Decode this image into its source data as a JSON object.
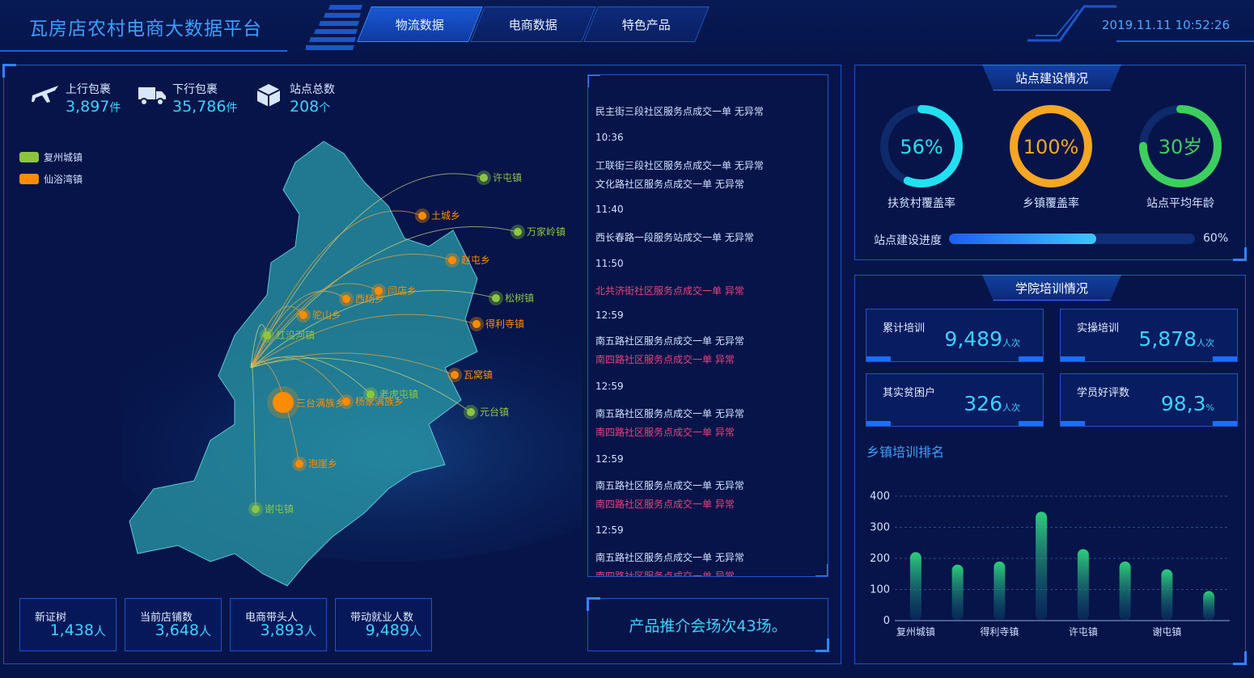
{
  "header": {
    "title": "瓦房店农村电商大数据平台",
    "tabs": [
      {
        "label": "物流数据",
        "active": true
      },
      {
        "label": "电商数据",
        "active": false
      },
      {
        "label": "特色产品",
        "active": false
      }
    ],
    "datetime": "2019.11.11 10:52:26"
  },
  "stats": [
    {
      "label": "上行包裹",
      "value": "3,897",
      "unit": "件",
      "icon": "airplane-icon"
    },
    {
      "label": "下行包裹",
      "value": "35,786",
      "unit": "件",
      "icon": "truck-icon"
    },
    {
      "label": "站点总数",
      "value": "208",
      "unit": "个",
      "icon": "package-icon"
    }
  ],
  "legend": [
    {
      "label": "复州城镇",
      "color": "#8cc63f"
    },
    {
      "label": "仙浴湾镇",
      "color": "#ff8c00"
    }
  ],
  "map": {
    "hub": "三台满族乡",
    "towns": [
      {
        "name": "许屯镇",
        "type": "green"
      },
      {
        "name": "土城乡",
        "type": "orange"
      },
      {
        "name": "万家岭镇",
        "type": "green"
      },
      {
        "name": "赵屯乡",
        "type": "orange"
      },
      {
        "name": "闫店乡",
        "type": "orange"
      },
      {
        "name": "西杨乡",
        "type": "orange"
      },
      {
        "name": "松树镇",
        "type": "green"
      },
      {
        "name": "驼山乡",
        "type": "orange"
      },
      {
        "name": "得利寺镇",
        "type": "orange"
      },
      {
        "name": "红沿河镇",
        "type": "green"
      },
      {
        "name": "瓦窝镇",
        "type": "orange"
      },
      {
        "name": "老虎屯镇",
        "type": "green"
      },
      {
        "name": "杨家满族乡",
        "type": "orange"
      },
      {
        "name": "元台镇",
        "type": "green"
      },
      {
        "name": "泡崖乡",
        "type": "orange"
      },
      {
        "name": "谢屯镇",
        "type": "green"
      }
    ]
  },
  "feed": [
    {
      "text": "民主街三段社区服务点成交一单 无异常",
      "bad": false
    },
    {
      "text": "10:36",
      "bad": false
    },
    {
      "text": "工联街三段社区服务点成交一单 无异常",
      "bad": false
    },
    {
      "text": "文化路社区服务点成交一单 无异常",
      "bad": false
    },
    {
      "text": "11:40",
      "bad": false
    },
    {
      "text": "西长春路一段服务站成交一单 无异常",
      "bad": false
    },
    {
      "text": "11:50",
      "bad": false
    },
    {
      "text": "北共济街社区服务点成交一单 异常",
      "bad": true
    },
    {
      "text": "12:59",
      "bad": false
    },
    {
      "text": "南五路社区服务点成交一单 无异常",
      "bad": false
    },
    {
      "text": "南四路社区服务点成交一单 异常",
      "bad": true
    },
    {
      "text": "12:59",
      "bad": false
    },
    {
      "text": "南五路社区服务点成交一单 无异常",
      "bad": false
    },
    {
      "text": "南四路社区服务点成交一单 异常",
      "bad": true
    },
    {
      "text": "12:59",
      "bad": false
    },
    {
      "text": "南五路社区服务点成交一单 无异常",
      "bad": false
    },
    {
      "text": "南四路社区服务点成交一单 异常",
      "bad": true
    },
    {
      "text": "12:59",
      "bad": false
    },
    {
      "text": "南五路社区服务点成交一单 无异常",
      "bad": false
    },
    {
      "text": "南四路社区服务点成交一单 异常",
      "bad": true
    }
  ],
  "bottom_stats": [
    {
      "label": "新证树",
      "value": "1,438",
      "unit": "人"
    },
    {
      "label": "当前店铺数",
      "value": "3,648",
      "unit": "人"
    },
    {
      "label": "电商带头人",
      "value": "3,893",
      "unit": "人"
    },
    {
      "label": "带动就业人数",
      "value": "9,489",
      "unit": "人"
    }
  ],
  "promo": "产品推介会场次43场。",
  "site_construction": {
    "title": "站点建设情况",
    "gauges": [
      {
        "value": "56%",
        "percent": 56,
        "label": "扶贫村覆盖率",
        "color": "#22e0f0"
      },
      {
        "value": "100%",
        "percent": 100,
        "label": "乡镇覆盖率",
        "color": "#f5a623"
      },
      {
        "value": "30岁",
        "percent": 75,
        "label": "站点平均年龄",
        "color": "#3ccf5e"
      }
    ],
    "progress": {
      "label": "站点建设进度",
      "percent": 60,
      "text": "60%"
    }
  },
  "training": {
    "title": "学院培训情况",
    "boxes": [
      {
        "label": "累计培训",
        "value": "9,489",
        "unit": "人次"
      },
      {
        "label": "实操培训",
        "value": "5,878",
        "unit": "人次"
      },
      {
        "label": "其实贫困户",
        "value": "326",
        "unit": "人次"
      },
      {
        "label": "学员好评数",
        "value": "98,3",
        "unit": "%"
      }
    ],
    "ranking_title": "乡镇培训排名"
  },
  "chart_data": {
    "type": "bar",
    "categories": [
      "复州城镇",
      "",
      "得利寺镇",
      "",
      "许屯镇",
      "",
      "谢屯镇",
      ""
    ],
    "values": [
      220,
      180,
      190,
      350,
      230,
      190,
      165,
      95
    ],
    "ylim": [
      0,
      400
    ],
    "yticks": [
      "0",
      "100",
      "200",
      "300",
      "400"
    ],
    "bar_color": "#2ecf7a"
  }
}
